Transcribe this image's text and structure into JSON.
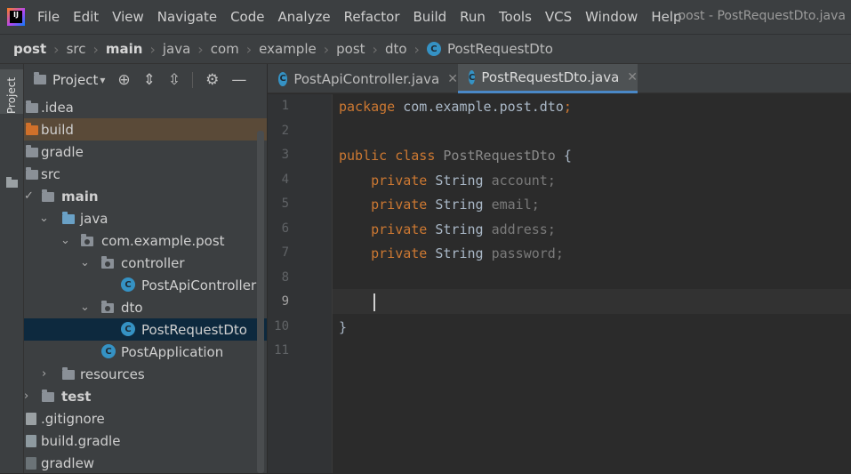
{
  "menubar": {
    "items": [
      "File",
      "Edit",
      "View",
      "Navigate",
      "Code",
      "Analyze",
      "Refactor",
      "Build",
      "Run",
      "Tools",
      "VCS",
      "Window",
      "Help"
    ],
    "window_title": "post - PostRequestDto.java"
  },
  "breadcrumb": {
    "items": [
      "post",
      "src",
      "main",
      "java",
      "com",
      "example",
      "post",
      "dto",
      "PostRequestDto"
    ]
  },
  "sidebar": {
    "tab_label": "Project"
  },
  "project_panel": {
    "title": "Project",
    "tree": [
      {
        "label": ".idea"
      },
      {
        "label": "build"
      },
      {
        "label": "gradle"
      },
      {
        "label": "src"
      },
      {
        "label": "main"
      },
      {
        "label": "java"
      },
      {
        "label": "com.example.post"
      },
      {
        "label": "controller"
      },
      {
        "label": "PostApiController"
      },
      {
        "label": "dto"
      },
      {
        "label": "PostRequestDto"
      },
      {
        "label": "PostApplication"
      },
      {
        "label": "resources"
      },
      {
        "label": "test"
      },
      {
        "label": ".gitignore"
      },
      {
        "label": "build.gradle"
      },
      {
        "label": "gradlew"
      }
    ]
  },
  "editor_tabs": [
    {
      "label": "PostApiController.java",
      "active": false
    },
    {
      "label": "PostRequestDto.java",
      "active": true
    }
  ],
  "editor": {
    "line_numbers": [
      "1",
      "2",
      "3",
      "4",
      "5",
      "6",
      "7",
      "8",
      "9",
      "10",
      "11"
    ],
    "current_line": "9",
    "code": {
      "package_kw": "package",
      "package_name": " com.example.post.dto",
      "semicolon": ";",
      "public_kw": "public",
      "class_kw": "class",
      "class_name": "PostRequestDto",
      "open_brace": "{",
      "close_brace": "}",
      "private_kw": "private",
      "type": "String",
      "fields": [
        "account",
        "email",
        "address",
        "password"
      ]
    }
  }
}
